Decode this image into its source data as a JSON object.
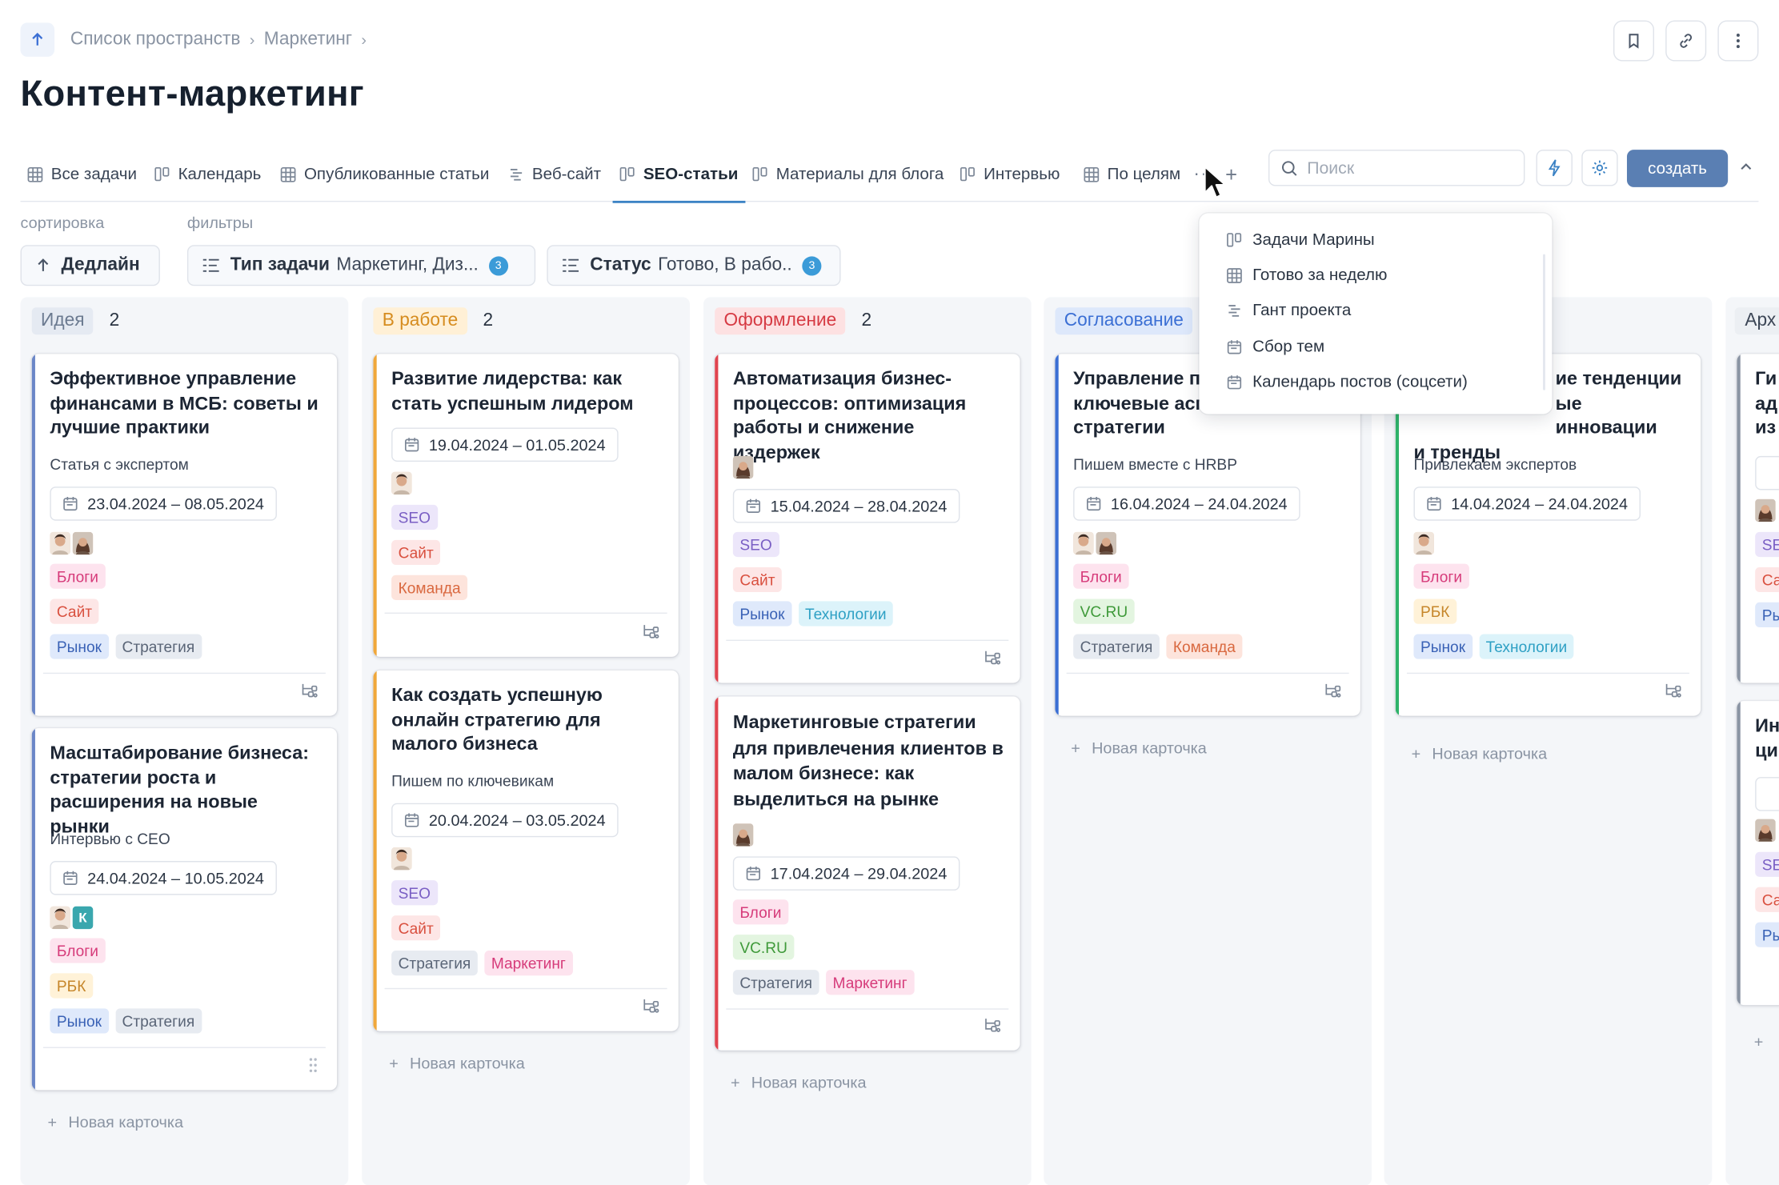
{
  "breadcrumb": {
    "items": [
      "Список пространств",
      "Маркетинг"
    ],
    "sep": "›"
  },
  "page_title": "Контент-маркетинг",
  "tabs": [
    {
      "label": "Все задачи",
      "icon": "table-icon"
    },
    {
      "label": "Календарь",
      "icon": "kanban-icon"
    },
    {
      "label": "Опубликованные статьи",
      "icon": "table-icon"
    },
    {
      "label": "Веб-сайт",
      "icon": "gantt-icon"
    },
    {
      "label": "SEO-статьи",
      "icon": "kanban-icon",
      "active": true
    },
    {
      "label": "Материалы для блога",
      "icon": "kanban-icon"
    },
    {
      "label": "Интервью",
      "icon": "kanban-icon"
    },
    {
      "label": "По целям",
      "icon": "table-icon"
    }
  ],
  "tab_more": "···",
  "tab_add": "+",
  "search": {
    "placeholder": "Поиск"
  },
  "create_label": "создать",
  "sort": {
    "label": "сортировка",
    "value": "Дедлайн"
  },
  "filters": {
    "label": "фильтры",
    "items": [
      {
        "name": "Тип задачи",
        "value": "Маркетинг, Диз...",
        "count": "3"
      },
      {
        "name": "Статус",
        "value": "Готово, В рабо..",
        "count": "3"
      }
    ]
  },
  "dropdown": {
    "items": [
      {
        "label": "Задачи Марины",
        "icon": "kanban-icon"
      },
      {
        "label": "Готово за неделю",
        "icon": "table-icon"
      },
      {
        "label": "Гант проекта",
        "icon": "gantt-icon"
      },
      {
        "label": "Сбор тем",
        "icon": "calendar-icon"
      },
      {
        "label": "Календарь постов (соцсети)",
        "icon": "calendar-icon"
      }
    ]
  },
  "new_card_label": "Новая карточка",
  "columns": [
    {
      "name": "Идея",
      "count": "2",
      "color": "#6b87c7",
      "cards": [
        {
          "title": "Эффективное управление финансами в МСБ: советы и лучшие практики",
          "subtitle": "Статья с экспертом",
          "date": "23.04.2024 – 08.05.2024",
          "tags": [
            "Блоги",
            "Сайт",
            "Рынок",
            "Стратегия"
          ]
        },
        {
          "title": "Масштабирование бизнеса: стратегии роста и расширения на новые рынки",
          "subtitle": "Интервью с CEO",
          "date": "24.04.2024 – 10.05.2024",
          "avatar_letter": "К",
          "tags": [
            "Блоги",
            "РБК",
            "Рынок",
            "Стратегия"
          ]
        }
      ]
    },
    {
      "name": "В работе",
      "count": "2",
      "color": "#f0a73a",
      "cards": [
        {
          "title": "Развитие лидерства: как стать успешным лидером",
          "date": "19.04.2024 – 01.05.2024",
          "tags": [
            "SEO",
            "Сайт",
            "Команда"
          ]
        },
        {
          "title": "Как создать успешную онлайн стратегию для малого бизнеса",
          "subtitle": "Пишем по ключевикам",
          "date": "20.04.2024 – 03.05.2024",
          "tags": [
            "SEO",
            "Сайт",
            "Стратегия",
            "Маркетинг"
          ]
        }
      ]
    },
    {
      "name": "Оформление",
      "count": "2",
      "color": "#e0444f",
      "cards": [
        {
          "title": "Автоматизация бизнес-процессов: оптимизация работы и снижение издержек",
          "date": "15.04.2024 – 28.04.2024",
          "tags": [
            "SEO",
            "Сайт",
            "Рынок",
            "Технологии"
          ]
        },
        {
          "title": "Маркетинговые стратегии для привлечения клиентов в малом бизнесе: как выделиться на рынке",
          "date": "17.04.2024 – 29.04.2024",
          "tags": [
            "Блоги",
            "VC.RU",
            "Стратегия",
            "Маркетинг"
          ]
        }
      ]
    },
    {
      "name": "Согласование",
      "count": "",
      "color": "#3b6fd4",
      "cards": [
        {
          "title": "Управление п… ключевые асп… стратегии",
          "title_lines": [
            "Управление п",
            "ключевые асп",
            "стратегии"
          ],
          "subtitle": "Пишем вместе с HRBP",
          "date": "16.04.2024 – 24.04.2024",
          "tags": [
            "Блоги",
            "VC.RU",
            "Стратегия",
            "Команда"
          ]
        }
      ]
    },
    {
      "name": "",
      "count": "",
      "color": "#2fb36a",
      "cards": [
        {
          "title_lines": [
            "ие тенденции",
            "ые инновации",
            "и тренды"
          ],
          "subtitle": "Привлекаем экспертов",
          "date": "14.04.2024 – 24.04.2024",
          "tags": [
            "Блоги",
            "РБК",
            "Рынок",
            "Технологии"
          ]
        }
      ]
    },
    {
      "name": "Арх",
      "count": "",
      "color": "#8a94a3",
      "cards": [
        {
          "title_lines": [
            "Ги",
            "ад",
            "из"
          ],
          "tags": [
            "SE",
            "Са",
            "Ры"
          ]
        },
        {
          "title_lines": [
            "Ин",
            "ци"
          ],
          "tags": [
            "SE",
            "Са",
            "Ры"
          ]
        }
      ]
    }
  ],
  "colors": {
    "accent": "#3b82c4",
    "create_button": "#5a7fb3"
  }
}
